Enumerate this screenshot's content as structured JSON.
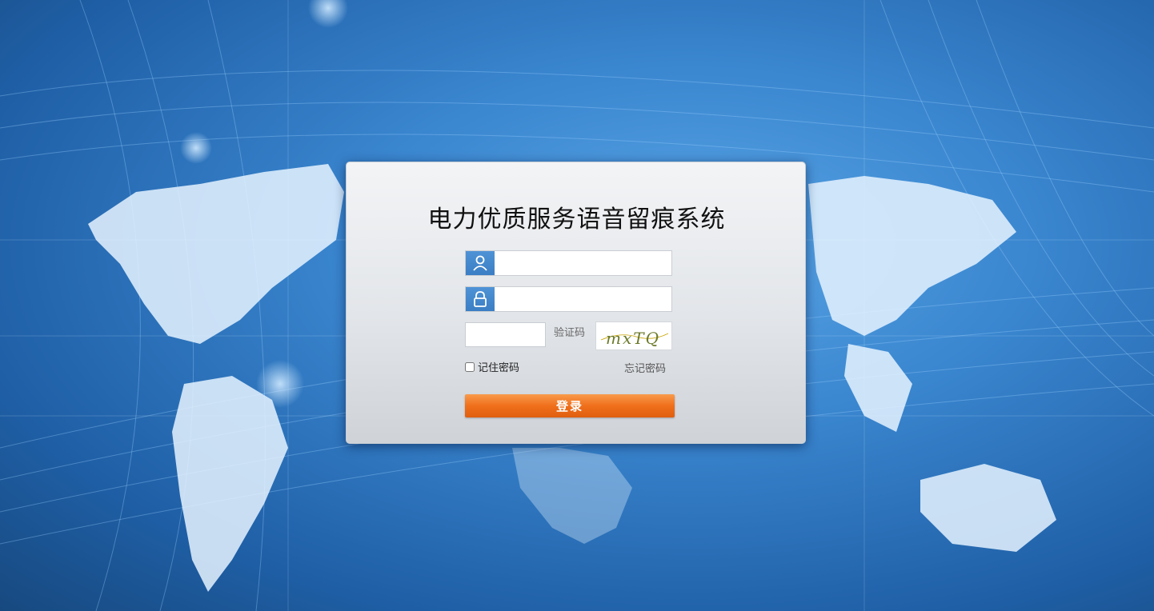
{
  "app": {
    "title": "电力优质服务语音留痕系统"
  },
  "login": {
    "username_value": "",
    "username_placeholder": "",
    "password_value": "",
    "password_placeholder": "",
    "captcha_value": "",
    "captcha_label": "验证码",
    "captcha_text": "mxTQ",
    "remember_label": "记住密码",
    "remember_checked": false,
    "forgot_label": "忘记密码",
    "submit_label": "登录"
  },
  "icons": {
    "user": "user-icon",
    "lock": "lock-icon"
  },
  "colors": {
    "accent_blue": "#4a8ed3",
    "button_orange": "#ef6f1b",
    "background_blue": "#3a86cf"
  }
}
